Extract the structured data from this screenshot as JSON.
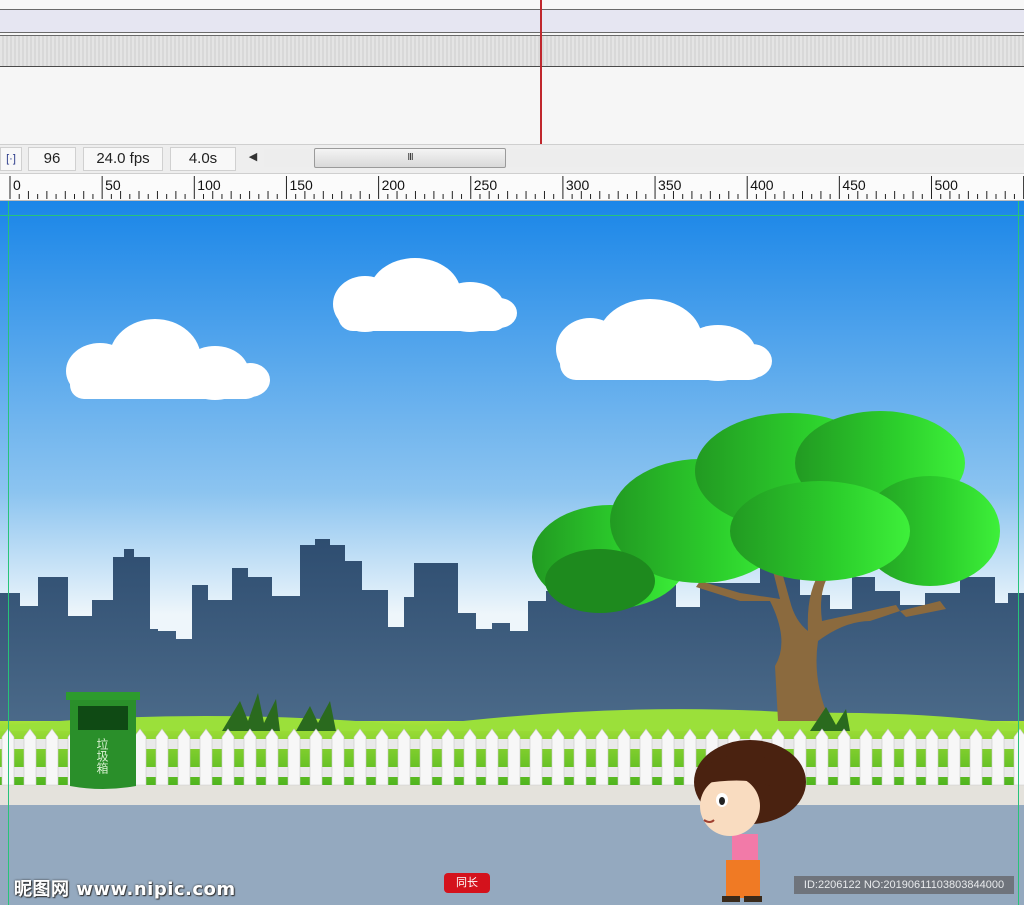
{
  "timeline": {
    "frame_number": "96",
    "frame_rate": "24.0 fps",
    "elapsed_time": "4.0s",
    "fit_icon": "fit-frame-icon",
    "scroll_left_icon": "chevron-left-icon",
    "scroll_thumb_grip": "III"
  },
  "ruler": {
    "labels": [
      "0",
      "50",
      "100",
      "150",
      "200",
      "250",
      "300",
      "350",
      "400",
      "450",
      "500"
    ]
  },
  "stage": {
    "trash_bin_label": "垃圾箱",
    "colors": {
      "sky_top": "#1a86e8",
      "sky_bottom": "#e9f4fb",
      "skyline": "#3a5878",
      "grass": "#7fcf26",
      "fence": "#f1f1f1",
      "road": "#93a9bf",
      "tree_leaves": "#2fc729",
      "trash_bin": "#2a8f2a"
    }
  },
  "watermark": {
    "site": "昵图网 www.nipic.com",
    "stamp": "同长",
    "id_text": "ID:2206122 NO:20190611103803844000"
  }
}
